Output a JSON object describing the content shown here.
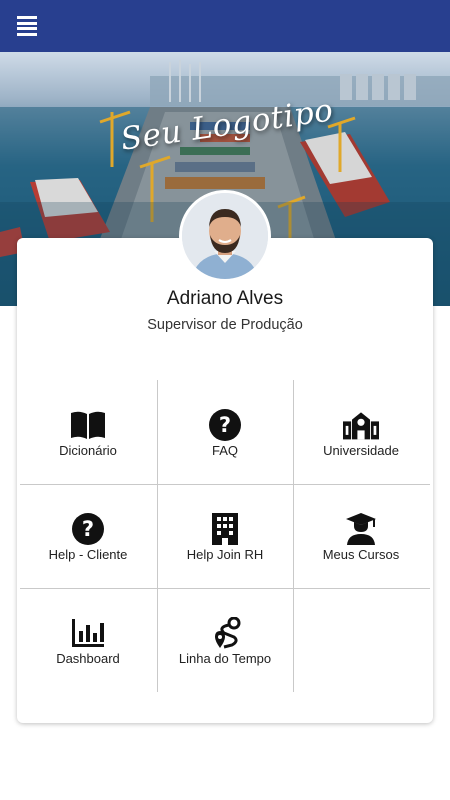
{
  "header": {
    "menu_icon": "hamburger-menu-icon",
    "background_color": "#283f8f"
  },
  "banner": {
    "logo_text": "Seu Logotipo"
  },
  "profile": {
    "name": "Adriano Alves",
    "role": "Supervisor de Produção"
  },
  "menu": [
    {
      "label": "Dicionário",
      "icon": "book-icon"
    },
    {
      "label": "FAQ",
      "icon": "question-circle-icon"
    },
    {
      "label": "Universidade",
      "icon": "school-building-icon"
    },
    {
      "label": "Help - Cliente",
      "icon": "question-circle-icon"
    },
    {
      "label": "Help Join RH",
      "icon": "office-building-icon"
    },
    {
      "label": "Meus Cursos",
      "icon": "graduate-user-icon"
    },
    {
      "label": "Dashboard",
      "icon": "bar-chart-icon"
    },
    {
      "label": "Linha do Tempo",
      "icon": "route-icon"
    }
  ]
}
